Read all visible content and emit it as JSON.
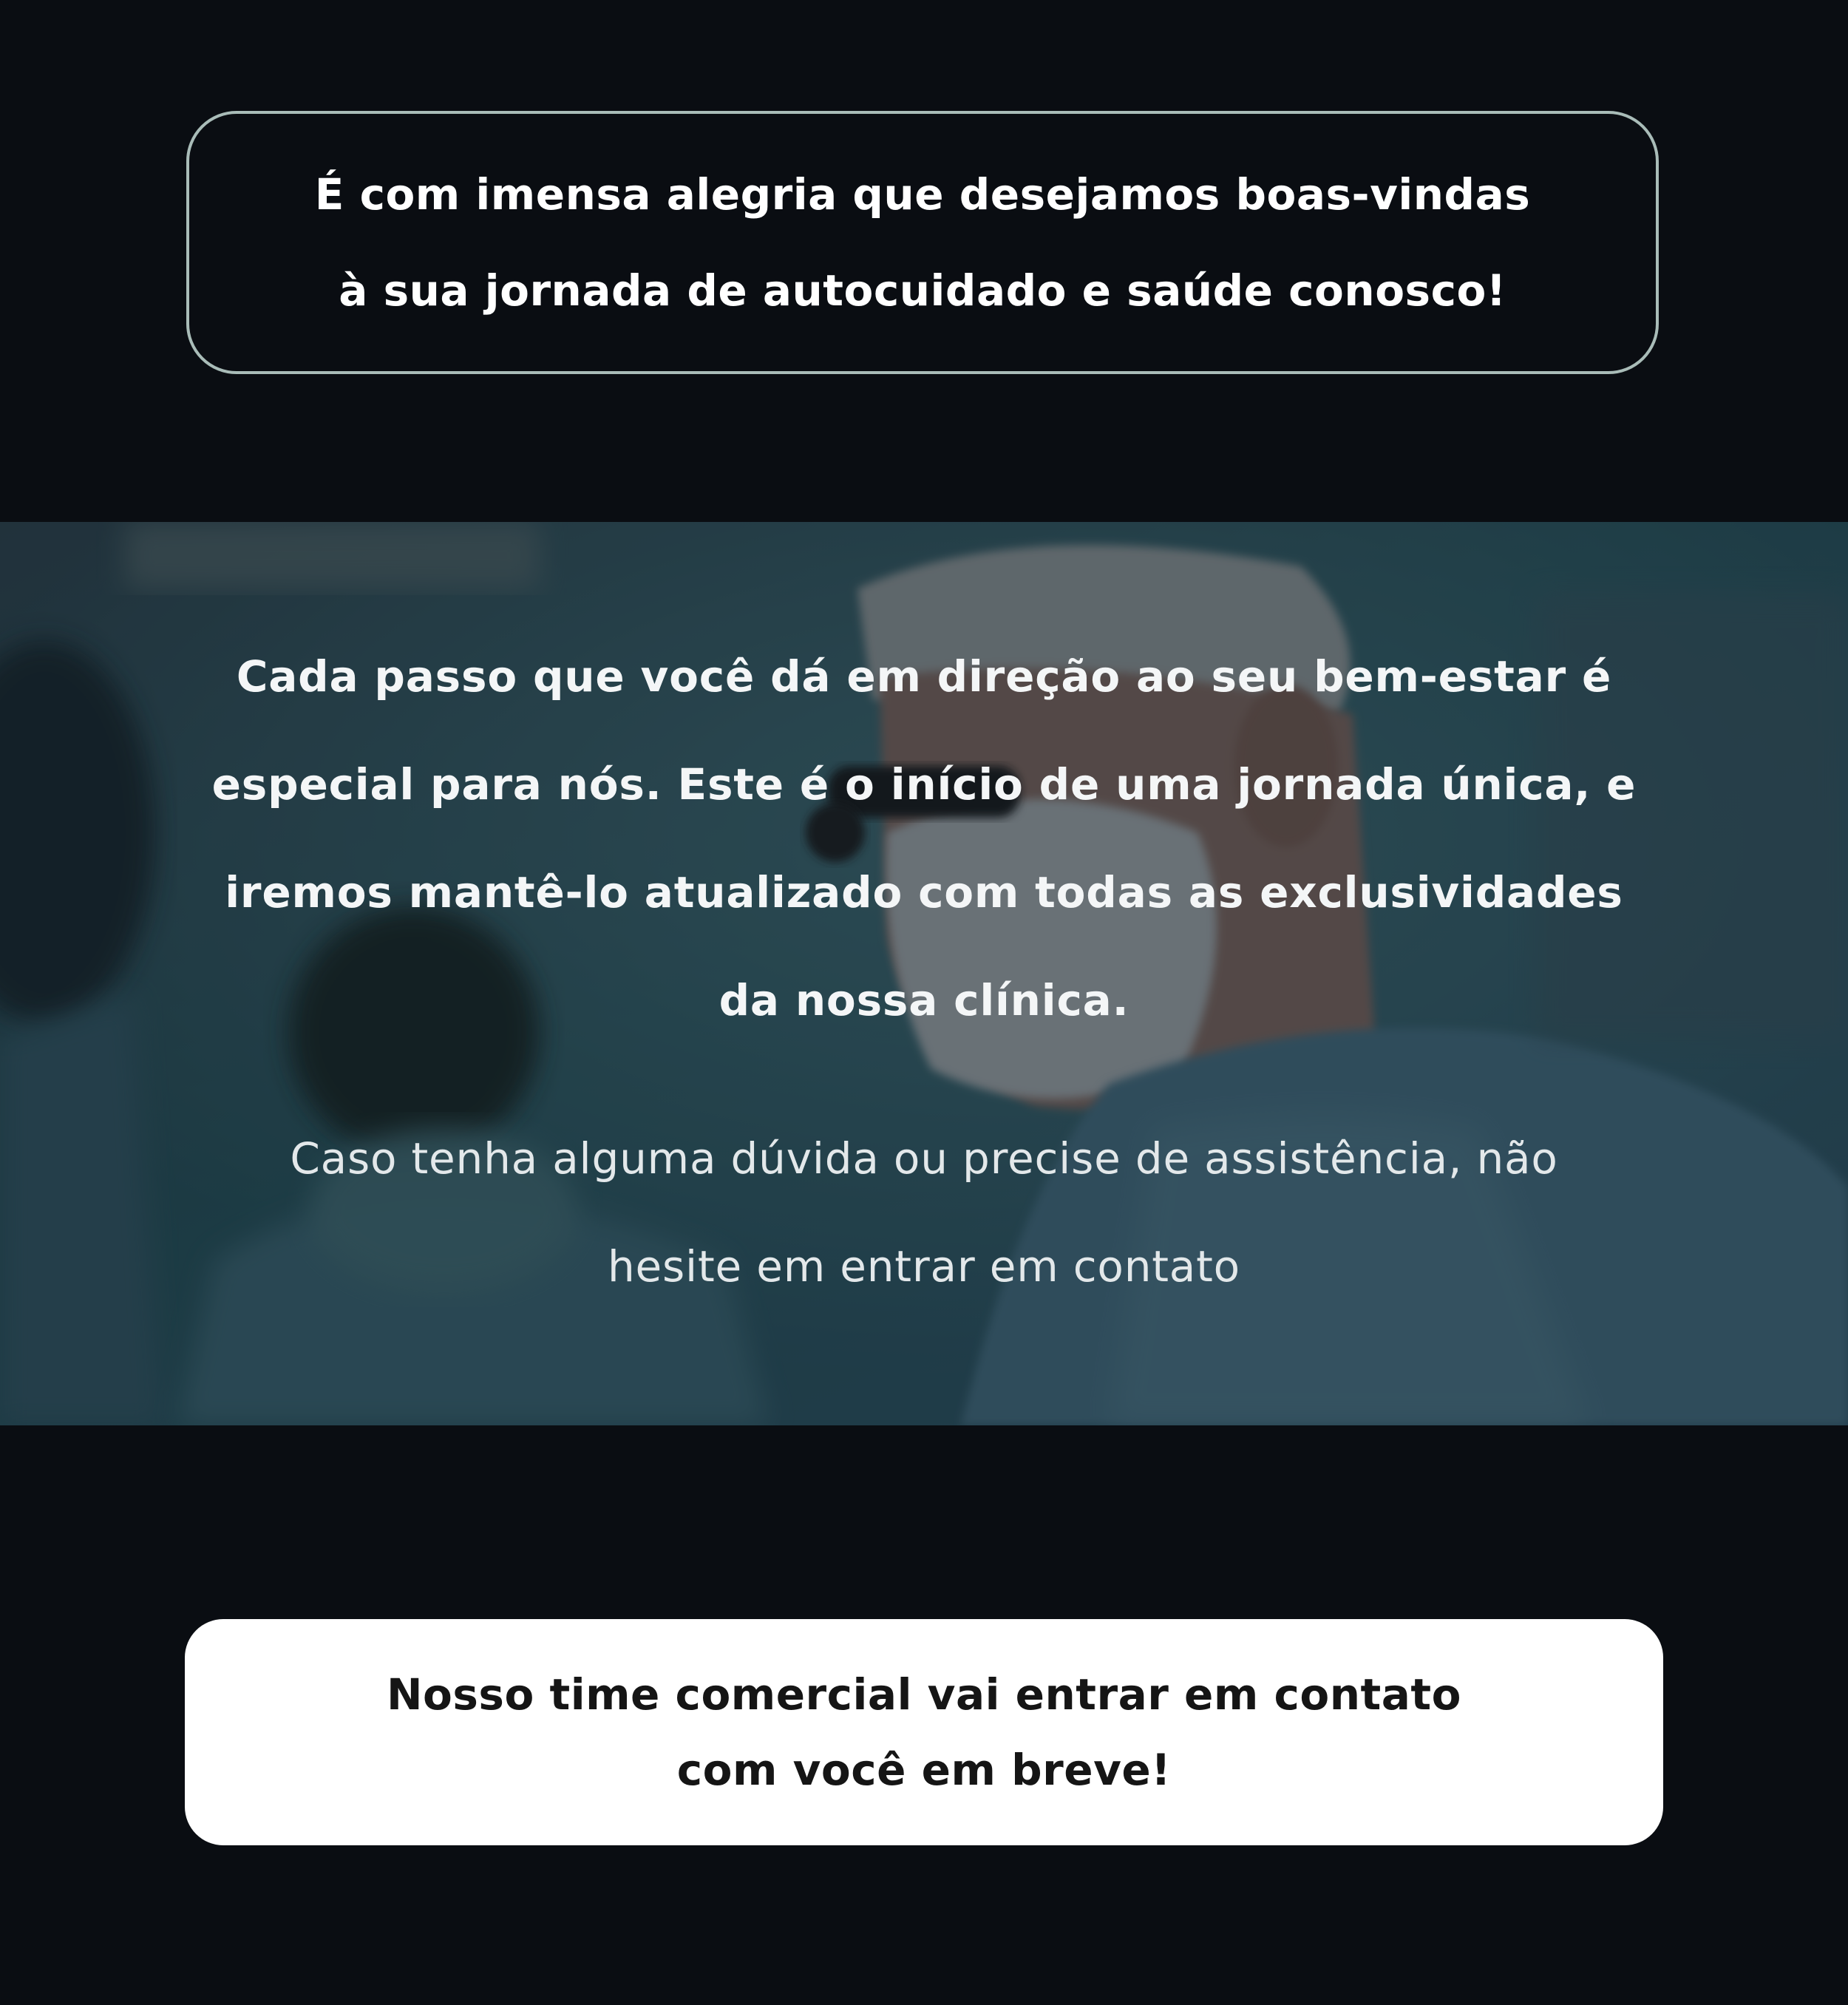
{
  "welcome": {
    "line1": "É com imensa alegria que desejamos boas-vindas",
    "line2": "à sua jornada de autocuidado e saúde conosco!"
  },
  "hero": {
    "image": "surgeons-operating-room-photo",
    "bold_lines": [
      "Cada passo que você dá em direção ao seu bem-estar é",
      "especial para nós. Este é o início de uma jornada única, e",
      "iremos mantê-lo atualizado com todas as exclusividades",
      "da nossa clínica."
    ],
    "light_lines": [
      "Caso tenha alguma dúvida ou precise de assistência, não",
      "hesite em entrar em contato"
    ]
  },
  "cta": {
    "line1": "Nosso time comercial vai entrar em contato",
    "line2": "com você em breve!"
  },
  "colors": {
    "page_background": "#0a0d12",
    "box_border": "#a9bcb8",
    "card_background": "#ffffff",
    "card_text": "#151515"
  }
}
